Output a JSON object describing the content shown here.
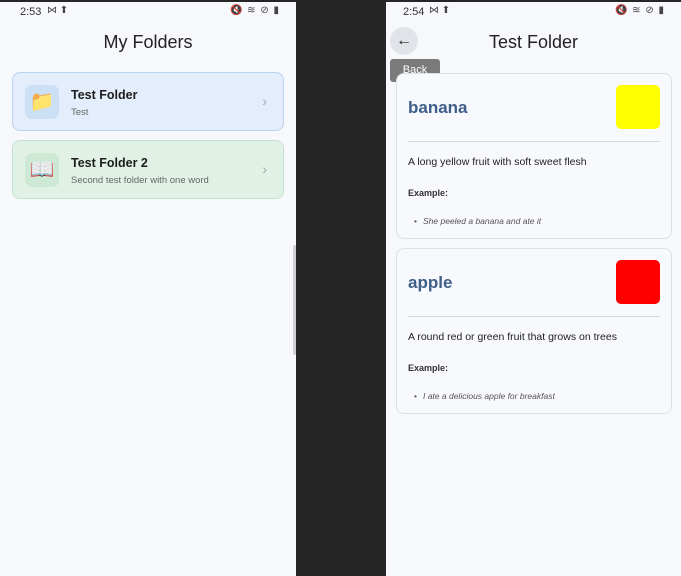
{
  "left_screen": {
    "status": {
      "time": "2:53",
      "left_icons": "⋈ ⬆",
      "right_icons": "🔇 ≋ ⊘ ▮"
    },
    "title": "My Folders",
    "folders": [
      {
        "name": "Test Folder",
        "description": "Test",
        "icon": "📁",
        "icon_name": "folder-icon",
        "bg": "#e3edfb",
        "border": "#bcd3f0",
        "icon_bg": "#cbdff5"
      },
      {
        "name": "Test Folder 2",
        "description": "Second test folder with one word",
        "icon": "📖",
        "icon_name": "book-icon",
        "bg": "#e2f1e6",
        "border": "#c2e0cb",
        "icon_bg": "#cde8d5"
      }
    ],
    "chevron": "›"
  },
  "right_screen": {
    "status": {
      "time": "2:54",
      "left_icons": "⋈ ⬆",
      "right_icons": "🔇 ≋ ⊘ ▮"
    },
    "title": "Test Folder",
    "back_icon": "←",
    "tooltip": "Back",
    "example_label": "Example:",
    "bullet": "•",
    "words": [
      {
        "word": "banana",
        "color": "#ffff00",
        "definition": "A long yellow fruit with soft sweet flesh",
        "example": "She peeled a banana and ate it"
      },
      {
        "word": "apple",
        "color": "#ff0000",
        "definition": "A round red or green fruit that grows on trees",
        "example": "I ate a delicious apple for breakfast"
      }
    ]
  }
}
